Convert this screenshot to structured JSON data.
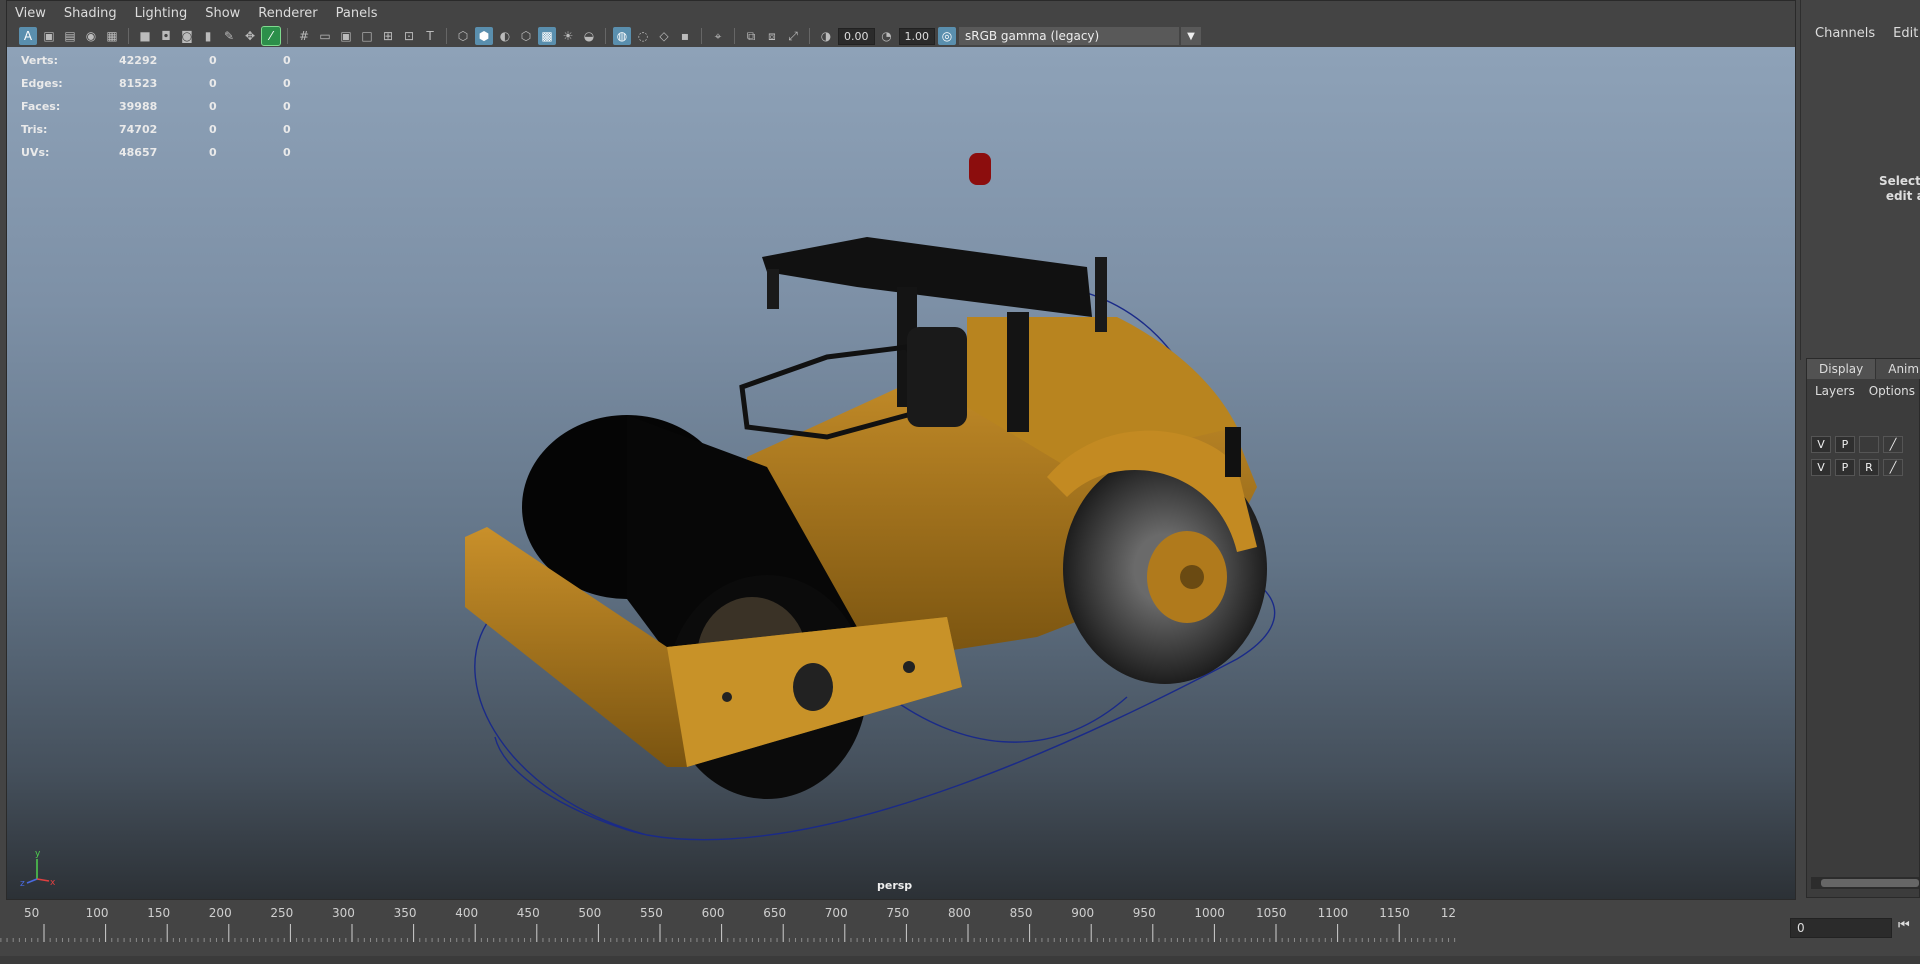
{
  "menu": [
    "View",
    "Shading",
    "Lighting",
    "Show",
    "Renderer",
    "Panels"
  ],
  "toolbar": {
    "exposure_value": "0.00",
    "gamma_value": "1.00",
    "colorspace": "sRGB gamma (legacy)"
  },
  "hud": {
    "rows": [
      {
        "label": "Verts:",
        "v1": "42292",
        "v2": "0",
        "v3": "0"
      },
      {
        "label": "Edges:",
        "v1": "81523",
        "v2": "0",
        "v3": "0"
      },
      {
        "label": "Faces:",
        "v1": "39988",
        "v2": "0",
        "v3": "0"
      },
      {
        "label": "Tris:",
        "v1": "74702",
        "v2": "0",
        "v3": "0"
      },
      {
        "label": "UVs:",
        "v1": "48657",
        "v2": "0",
        "v3": "0"
      }
    ]
  },
  "viewport": {
    "camera_label": "persp",
    "axis_x": "x",
    "axis_y": "y",
    "axis_z": "z"
  },
  "channel_box": {
    "tab_channels": "Channels",
    "tab_edit": "Edit",
    "hint_line1": "Select object",
    "hint_line2": "edit and set"
  },
  "layer_editor": {
    "tab_display": "Display",
    "tab_anim": "Anim",
    "sub_layers": "Layers",
    "sub_options": "Options",
    "row1": {
      "v": "V",
      "p": "P",
      "r": ""
    },
    "row2": {
      "v": "V",
      "p": "P",
      "r": "R"
    }
  },
  "timeline": {
    "ticks": [
      "50",
      "100",
      "150",
      "200",
      "250",
      "300",
      "350",
      "400",
      "450",
      "500",
      "550",
      "600",
      "650",
      "700",
      "750",
      "800",
      "850",
      "900",
      "950",
      "1000",
      "1050",
      "1100",
      "1150",
      "12"
    ],
    "current_frame": "0"
  }
}
